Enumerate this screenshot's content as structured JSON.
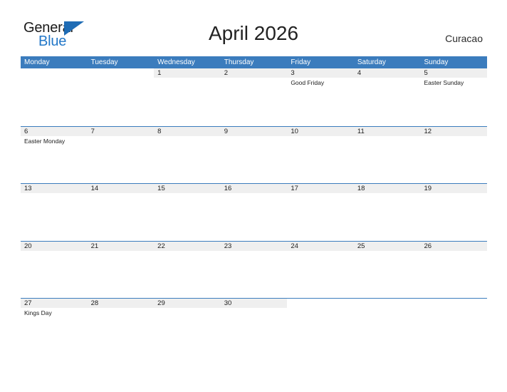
{
  "brand": {
    "name_part1": "General",
    "name_part2": "Blue",
    "accent_color": "#1f6cb5",
    "triangle_icon": "logo-triangle-icon"
  },
  "header": {
    "title": "April 2026",
    "country": "Curacao"
  },
  "theme": {
    "header_blue": "#3b7cbd",
    "day_band_gray": "#efefef",
    "text_dark": "#1c1c1c",
    "page_background": "#ffffff"
  },
  "calendar": {
    "month": "April",
    "year": "2026",
    "weekday_headers": [
      "Monday",
      "Tuesday",
      "Wednesday",
      "Thursday",
      "Friday",
      "Saturday",
      "Sunday"
    ],
    "weeks": [
      [
        {
          "day": "",
          "holiday": "",
          "blank": true
        },
        {
          "day": "",
          "holiday": "",
          "blank": true
        },
        {
          "day": "1",
          "holiday": ""
        },
        {
          "day": "2",
          "holiday": ""
        },
        {
          "day": "3",
          "holiday": "Good Friday"
        },
        {
          "day": "4",
          "holiday": ""
        },
        {
          "day": "5",
          "holiday": "Easter Sunday"
        }
      ],
      [
        {
          "day": "6",
          "holiday": "Easter Monday"
        },
        {
          "day": "7",
          "holiday": ""
        },
        {
          "day": "8",
          "holiday": ""
        },
        {
          "day": "9",
          "holiday": ""
        },
        {
          "day": "10",
          "holiday": ""
        },
        {
          "day": "11",
          "holiday": ""
        },
        {
          "day": "12",
          "holiday": ""
        }
      ],
      [
        {
          "day": "13",
          "holiday": ""
        },
        {
          "day": "14",
          "holiday": ""
        },
        {
          "day": "15",
          "holiday": ""
        },
        {
          "day": "16",
          "holiday": ""
        },
        {
          "day": "17",
          "holiday": ""
        },
        {
          "day": "18",
          "holiday": ""
        },
        {
          "day": "19",
          "holiday": ""
        }
      ],
      [
        {
          "day": "20",
          "holiday": ""
        },
        {
          "day": "21",
          "holiday": ""
        },
        {
          "day": "22",
          "holiday": ""
        },
        {
          "day": "23",
          "holiday": ""
        },
        {
          "day": "24",
          "holiday": ""
        },
        {
          "day": "25",
          "holiday": ""
        },
        {
          "day": "26",
          "holiday": ""
        }
      ],
      [
        {
          "day": "27",
          "holiday": "Kings Day"
        },
        {
          "day": "28",
          "holiday": ""
        },
        {
          "day": "29",
          "holiday": ""
        },
        {
          "day": "30",
          "holiday": ""
        },
        {
          "day": "",
          "holiday": "",
          "blank": true
        },
        {
          "day": "",
          "holiday": "",
          "blank": true
        },
        {
          "day": "",
          "holiday": "",
          "blank": true
        }
      ]
    ]
  }
}
